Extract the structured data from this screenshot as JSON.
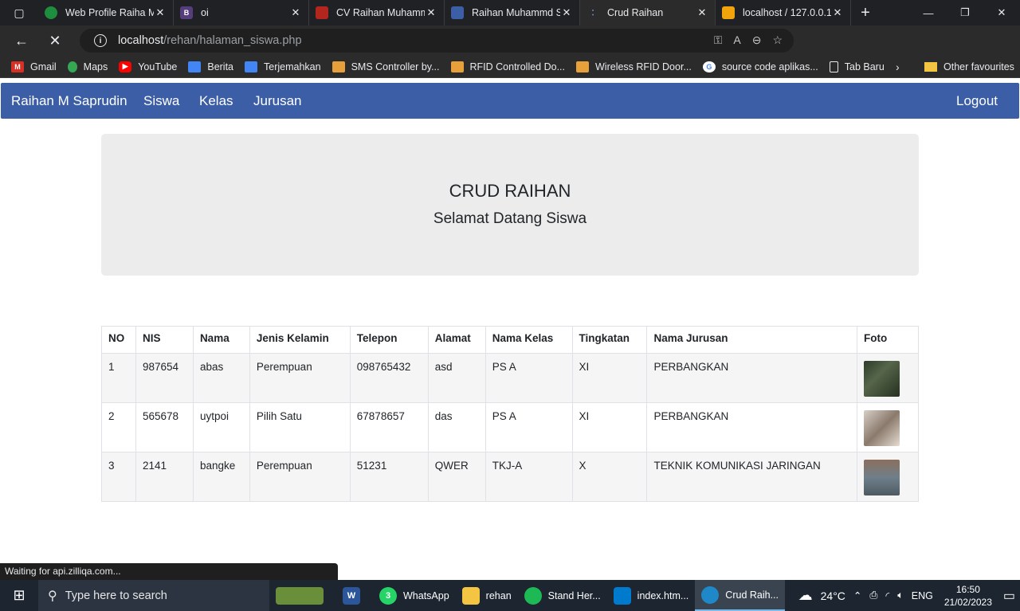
{
  "browser": {
    "tabs": [
      {
        "label": "Web Profile Raiha M",
        "icon": "globe-icon",
        "color": "#1e8e3e"
      },
      {
        "label": "oi",
        "icon": "bootstrap-icon",
        "color": "#563d7c"
      },
      {
        "label": "CV Raihan Muhamm",
        "icon": "pdf-icon",
        "color": "#b3261e"
      },
      {
        "label": "Raihan Muhammd S",
        "icon": "calendar-icon",
        "color": "#3b5ea6"
      },
      {
        "label": "Crud Raihan",
        "icon": "loading-icon",
        "color": "#2b2b2b",
        "active": true
      },
      {
        "label": "localhost / 127.0.0.1",
        "icon": "phpmyadmin-icon",
        "color": "#f0a30a"
      }
    ],
    "url_host": "localhost",
    "url_path": "/rehan/halaman_siswa.php",
    "bookmarks": [
      {
        "label": "Gmail",
        "icon": "gmail-icon",
        "color": "#d93025"
      },
      {
        "label": "Maps",
        "icon": "maps-icon",
        "color": "#34a853"
      },
      {
        "label": "YouTube",
        "icon": "youtube-icon",
        "color": "#ff0000"
      },
      {
        "label": "Berita",
        "icon": "news-icon",
        "color": "#4285f4"
      },
      {
        "label": "Terjemahkan",
        "icon": "translate-icon",
        "color": "#4285f4"
      },
      {
        "label": "SMS Controller by...",
        "icon": "chip-icon",
        "color": "#e8a13a"
      },
      {
        "label": "RFID Controlled Do...",
        "icon": "chip-icon",
        "color": "#e8a13a"
      },
      {
        "label": "Wireless RFID Door...",
        "icon": "chip-icon",
        "color": "#e8a13a"
      },
      {
        "label": "source code aplikas...",
        "icon": "google-icon",
        "color": "#ffffff"
      },
      {
        "label": "Tab Baru",
        "icon": "page-icon",
        "color": "#2b2b2b"
      }
    ],
    "other_favourites": "Other favourites",
    "status_text": "Waiting for api.zilliqa.com..."
  },
  "navbar": {
    "brand": "Raihan M Saprudin",
    "links": [
      "Siswa",
      "Kelas",
      "Jurusan"
    ],
    "logout": "Logout",
    "color": "#3b5ea6"
  },
  "jumbotron": {
    "title": "CRUD RAIHAN",
    "subtitle": "Selamat Datang Siswa"
  },
  "table": {
    "headers": [
      "NO",
      "NIS",
      "Nama",
      "Jenis Kelamin",
      "Telepon",
      "Alamat",
      "Nama Kelas",
      "Tingkatan",
      "Nama Jurusan",
      "Foto"
    ],
    "rows": [
      {
        "no": "1",
        "nis": "987654",
        "nama": "abas",
        "jk": "Perempuan",
        "telepon": "098765432",
        "alamat": "asd",
        "kelas": "PS A",
        "tingkatan": "XI",
        "jurusan": "PERBANGKAN",
        "foto_color": "#3a4a3a"
      },
      {
        "no": "2",
        "nis": "565678",
        "nama": "uytpoi",
        "jk": "Pilih Satu",
        "telepon": "67878657",
        "alamat": "das",
        "kelas": "PS A",
        "tingkatan": "XI",
        "jurusan": "PERBANGKAN",
        "foto_color": "#b8a79a"
      },
      {
        "no": "3",
        "nis": "2141",
        "nama": "bangke",
        "jk": "Perempuan",
        "telepon": "51231",
        "alamat": "QWER",
        "kelas": "TKJ-A",
        "tingkatan": "X",
        "jurusan": "TEKNIK KOMUNIKASI JARINGAN",
        "foto_color": "#6f7f8a"
      }
    ]
  },
  "taskbar": {
    "search_placeholder": "Type here to search",
    "apps": [
      {
        "label": "",
        "icon": "widgets-icon",
        "color": "#6a8f3a"
      },
      {
        "label": "",
        "icon": "word-icon",
        "color": "#2b579a"
      },
      {
        "label": "WhatsApp",
        "icon": "whatsapp-icon",
        "color": "#25d366",
        "badge": "3"
      },
      {
        "label": "rehan",
        "icon": "folder-icon",
        "color": "#f4c542"
      },
      {
        "label": "Stand Her...",
        "icon": "spotify-icon",
        "color": "#1db954"
      },
      {
        "label": "index.htm...",
        "icon": "vscode-icon",
        "color": "#007acc"
      },
      {
        "label": "Crud Raih...",
        "icon": "edge-icon",
        "color": "#1e88c8",
        "active": true
      }
    ],
    "weather": "24°C",
    "language": "ENG",
    "time": "16:50",
    "date": "21/02/2023"
  }
}
